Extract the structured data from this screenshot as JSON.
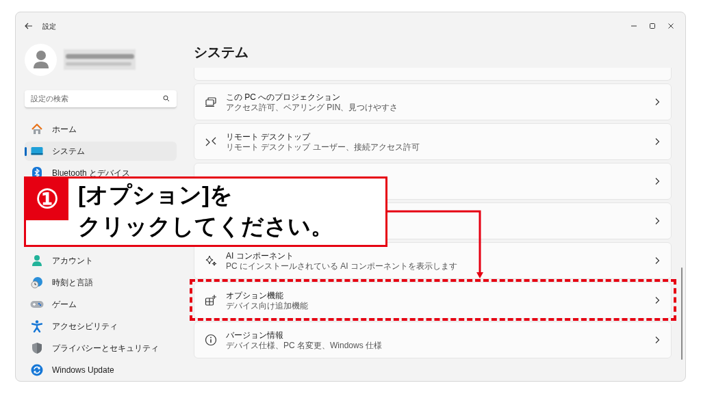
{
  "window": {
    "title": "設定"
  },
  "sidebar": {
    "search": {
      "placeholder": "設定の検索"
    },
    "items_top": [
      {
        "label": "ホーム",
        "selected": false
      },
      {
        "label": "システム",
        "selected": true
      },
      {
        "label": "Bluetooth とデバイス",
        "selected": false
      }
    ],
    "items_bottom": [
      {
        "label": "アカウント",
        "selected": false
      },
      {
        "label": "時刻と言語",
        "selected": false
      },
      {
        "label": "ゲーム",
        "selected": false
      },
      {
        "label": "アクセシビリティ",
        "selected": false
      },
      {
        "label": "プライバシーとセキュリティ",
        "selected": false
      },
      {
        "label": "Windows Update",
        "selected": false
      }
    ]
  },
  "page": {
    "title": "システム",
    "cards": [
      {
        "kind": "partial"
      },
      {
        "kind": "full",
        "title": "この PC へのプロジェクション",
        "subtitle": "アクセス許可、ペアリング PIN、見つけやすさ"
      },
      {
        "kind": "full",
        "title": "リモート デスクトップ",
        "subtitle": "リモート デスクトップ ユーザー、接続アクセス許可"
      },
      {
        "kind": "covered"
      },
      {
        "kind": "covered"
      },
      {
        "kind": "full",
        "title": "AI コンポーネント",
        "subtitle": "PC にインストールされている AI コンポーネントを表示します"
      },
      {
        "kind": "full",
        "title": "オプション機能",
        "subtitle": "デバイス向け追加機能"
      },
      {
        "kind": "full",
        "title": "バージョン情報",
        "subtitle": "デバイス仕様、PC 名変更、Windows 仕様"
      }
    ]
  },
  "callout": {
    "number": "①",
    "lines": [
      "[オプション]を",
      "クリックしてください。"
    ]
  }
}
